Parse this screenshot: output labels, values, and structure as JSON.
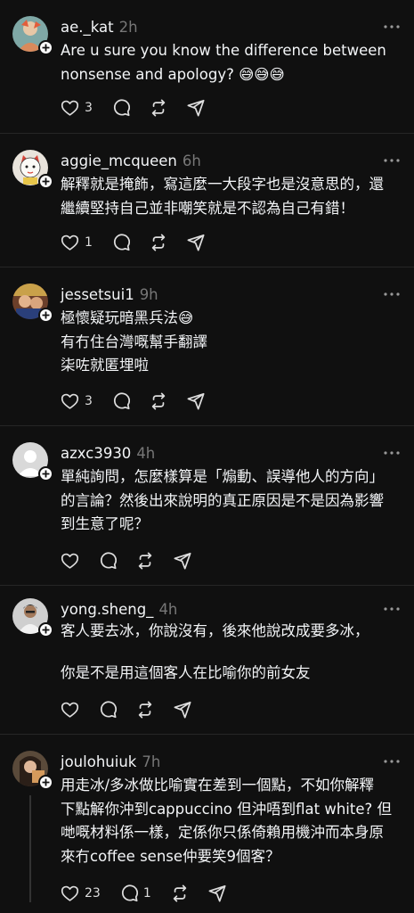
{
  "posts": [
    {
      "username": "ae._kat",
      "time": "2h",
      "text": "Are u sure you know the difference between\nnonsense and apology? 😅😅😅",
      "likes": "3",
      "replies": ""
    },
    {
      "username": "aggie_mcqueen",
      "time": "6h",
      "text": "解釋就是掩飾，寫這麼一大段字也是沒意思的，還\n繼續堅持自己並非嘲笑就是不認為自己有錯！",
      "likes": "1",
      "replies": ""
    },
    {
      "username": "jessetsui1",
      "time": "9h",
      "text": "極懷疑玩暗黑兵法😅\n有冇住台灣嘅幫手翻譯\n柒咗就匿埋啦",
      "likes": "3",
      "replies": ""
    },
    {
      "username": "azxc3930",
      "time": "4h",
      "text": "單純詢問，怎麼樣算是「煽動、誤導他人的方向」\n的言論？然後出來說明的真正原因是不是因為影響\n到生意了呢？",
      "likes": "",
      "replies": ""
    },
    {
      "username": "yong.sheng_",
      "time": "4h",
      "text": "客人要去冰，你說沒有，後來他說改成要多冰，\n\n你是不是用這個客人在比喻你的前女友",
      "likes": "",
      "replies": ""
    },
    {
      "username": "joulohuiuk",
      "time": "7h",
      "text": "用走冰/多冰做比喻實在差到一個點，不如你解釋\n下點解你沖到cappuccino 但沖唔到flat white? 但\n哋嘅材料係一樣，定係你只係倚賴用機沖而本身原\n來冇coffee sense仲要笑9個客？",
      "likes": "23",
      "replies": "1"
    }
  ],
  "icons": {
    "like": "heart-icon",
    "reply": "comment-icon",
    "repost": "repost-icon",
    "share": "send-icon",
    "more": "more-icon",
    "follow": "plus-icon"
  },
  "colors": {
    "background": "#101010",
    "text": "#f3f5f7",
    "muted": "#777777",
    "divider": "#262626"
  }
}
